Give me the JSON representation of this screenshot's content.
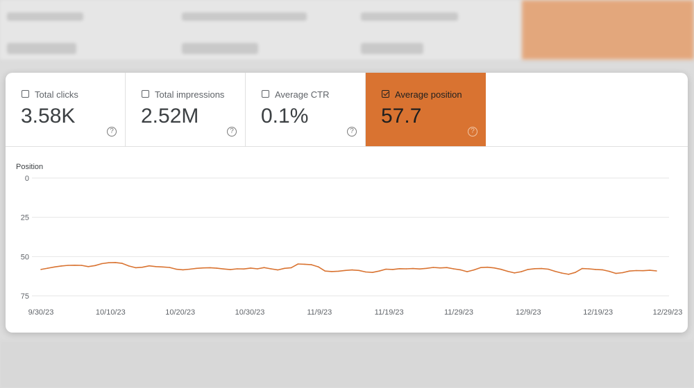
{
  "metrics": [
    {
      "label": "Total clicks",
      "value": "3.58K",
      "checked": false
    },
    {
      "label": "Total impressions",
      "value": "2.52M",
      "checked": false
    },
    {
      "label": "Average CTR",
      "value": "0.1%",
      "checked": false
    },
    {
      "label": "Average position",
      "value": "57.7",
      "checked": true
    }
  ],
  "colors": {
    "accent": "#d97331",
    "line": "#d97331"
  },
  "icons": {
    "checkbox": "checkbox-icon",
    "help": "help-circle-icon"
  },
  "help_glyph": "?",
  "chart_data": {
    "type": "line",
    "ylabel": "Position",
    "y_ticks": [
      "0",
      "25",
      "50",
      "75"
    ],
    "ylim": [
      0,
      75
    ],
    "y_inverted": true,
    "x_tick_labels": [
      "9/30/23",
      "10/10/23",
      "10/20/23",
      "10/30/23",
      "11/9/23",
      "11/19/23",
      "11/29/23",
      "12/9/23",
      "12/19/23",
      "12/29/23"
    ],
    "grid": true,
    "series": [
      {
        "x": [
          "9/30/23",
          "10/1/23",
          "10/2/23",
          "10/3/23",
          "10/4/23",
          "10/5/23",
          "10/6/23",
          "10/7/23",
          "10/8/23",
          "10/9/23",
          "10/10/23",
          "10/11/23",
          "10/12/23",
          "10/13/23",
          "10/14/23",
          "10/15/23",
          "10/16/23",
          "10/17/23",
          "10/18/23",
          "10/19/23",
          "10/20/23",
          "10/21/23",
          "10/22/23",
          "10/23/23",
          "10/24/23",
          "10/25/23",
          "10/26/23",
          "10/27/23",
          "10/28/23",
          "10/29/23",
          "10/30/23",
          "10/31/23",
          "11/1/23",
          "11/2/23",
          "11/3/23",
          "11/4/23",
          "11/5/23",
          "11/6/23",
          "11/7/23",
          "11/8/23",
          "11/9/23",
          "11/10/23",
          "11/11/23",
          "11/12/23",
          "11/13/23",
          "11/14/23",
          "11/15/23",
          "11/16/23",
          "11/17/23",
          "11/18/23",
          "11/19/23",
          "11/20/23",
          "11/21/23",
          "11/22/23",
          "11/23/23",
          "11/24/23",
          "11/25/23",
          "11/26/23",
          "11/27/23",
          "11/28/23",
          "11/29/23",
          "11/30/23",
          "12/1/23",
          "12/2/23",
          "12/3/23",
          "12/4/23",
          "12/5/23",
          "12/6/23",
          "12/7/23",
          "12/8/23",
          "12/9/23",
          "12/10/23",
          "12/11/23",
          "12/12/23",
          "12/13/23",
          "12/14/23",
          "12/15/23",
          "12/16/23",
          "12/17/23",
          "12/18/23",
          "12/19/23",
          "12/20/23",
          "12/21/23",
          "12/22/23",
          "12/23/23",
          "12/24/23",
          "12/25/23",
          "12/26/23",
          "12/27/23",
          "12/28/23",
          "12/29/23",
          "12/30/23"
        ],
        "values": [
          58.2,
          57.4,
          56.6,
          56.0,
          55.6,
          55.5,
          55.6,
          56.4,
          55.7,
          54.5,
          53.9,
          53.8,
          54.3,
          56.0,
          57.1,
          56.8,
          55.9,
          56.4,
          56.6,
          56.9,
          58.0,
          58.4,
          58.0,
          57.5,
          57.2,
          57.1,
          57.4,
          57.9,
          58.3,
          57.8,
          57.9,
          57.3,
          57.8,
          57.0,
          57.8,
          58.5,
          57.5,
          57.1,
          54.7,
          54.9,
          55.2,
          56.5,
          59.2,
          59.5,
          59.3,
          58.8,
          58.5,
          58.8,
          59.8,
          60.1,
          59.2,
          58.0,
          58.2,
          57.7,
          57.8,
          57.6,
          57.9,
          57.5,
          56.9,
          57.2,
          57.0,
          57.8,
          58.4,
          59.6,
          58.5,
          57.0,
          56.8,
          57.2,
          58.1,
          59.4,
          60.4,
          59.6,
          58.2,
          57.7,
          57.6,
          58.0,
          59.4,
          60.5,
          61.3,
          60.1,
          57.6,
          57.8,
          58.2,
          58.4,
          59.4,
          60.7,
          60.2,
          59.2,
          58.9,
          59.0,
          58.7,
          59.1
        ]
      }
    ]
  }
}
